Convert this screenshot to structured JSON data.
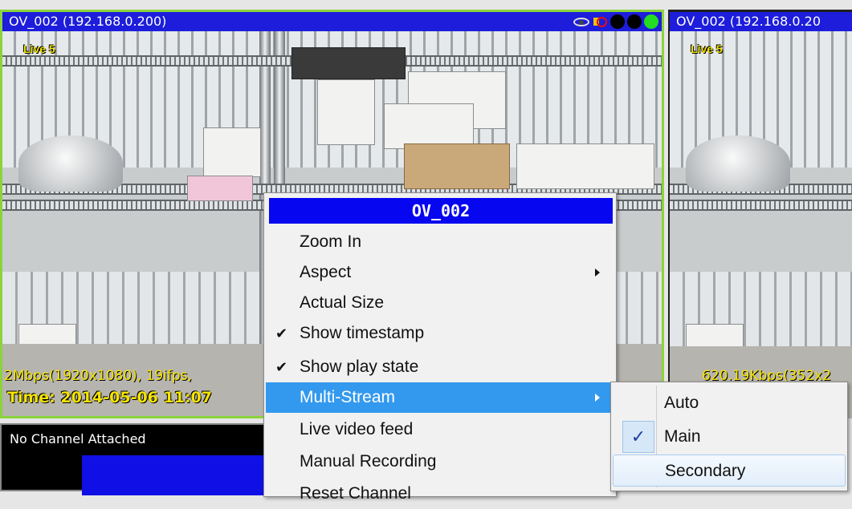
{
  "camera_main": {
    "title": "OV_002 (192.168.0.200)",
    "live_label": "Live 5",
    "rate_text": "2Mbps(1920x1080), 19ifps,",
    "time_text": "Time: 2014-05-06 11:07"
  },
  "camera_right": {
    "title": "OV_002 (192.168.0.20",
    "live_label": "Live 5",
    "rate_text": "620.19Kbps(352x2"
  },
  "no_channel": {
    "text": "No Channel Attached"
  },
  "context_menu": {
    "header": "OV_002",
    "items": [
      {
        "label": "Zoom In",
        "checked": false,
        "submenu": false
      },
      {
        "label": "Aspect",
        "checked": false,
        "submenu": true
      },
      {
        "label": "Actual Size",
        "checked": false,
        "submenu": false
      },
      {
        "label": "Show timestamp",
        "checked": true,
        "submenu": false
      },
      {
        "label": "Show play state",
        "checked": true,
        "submenu": false
      },
      {
        "label": "Multi-Stream",
        "checked": false,
        "submenu": true,
        "selected": true
      },
      {
        "label": "Live video feed",
        "checked": false,
        "submenu": false
      },
      {
        "label": "Manual Recording",
        "checked": false,
        "submenu": false
      },
      {
        "label": "Reset Channel",
        "checked": false,
        "submenu": false
      }
    ]
  },
  "multistream_submenu": {
    "items": [
      {
        "label": "Auto",
        "checked": false
      },
      {
        "label": "Main",
        "checked": true
      },
      {
        "label": "Secondary",
        "checked": false,
        "hover": true
      }
    ]
  },
  "symbols": {
    "check": "✔",
    "check_sub": "✓"
  },
  "colors": {
    "title_bar": "#1d1ddb",
    "menu_header": "#0606f0",
    "selected_item": "#3399ee",
    "active_border": "#8bd33a",
    "overlay_text": "#f4e400"
  }
}
